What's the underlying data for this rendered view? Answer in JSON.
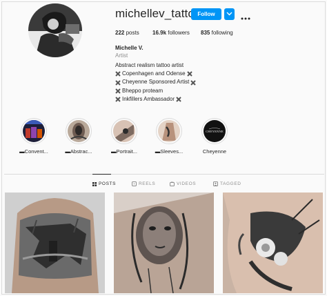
{
  "profile": {
    "username": "michellev_tattoo",
    "follow_label": "Follow",
    "posts_count": "222",
    "posts_label": "posts",
    "followers_count": "16.9k",
    "followers_label": "followers",
    "following_count": "835",
    "following_label": "following",
    "full_name": "Michelle V.",
    "category": "Artist",
    "bio_line1": "Abstract realism tattoo artist",
    "bio_line2": "Copenhagen and Odense",
    "bio_line3": "Cheyenne Sponsored Artist",
    "bio_line4": "Bheppo proteam",
    "bio_line5": "Inkfillers Ambassador"
  },
  "highlights": [
    {
      "label": "▬Convent..."
    },
    {
      "label": "▬Abstrac..."
    },
    {
      "label": "▬Portrait..."
    },
    {
      "label": "▬Sleeves..."
    },
    {
      "label": "Cheyenne"
    }
  ],
  "highlight_logo_text": "CHEYENNE",
  "tabs": {
    "posts": "POSTS",
    "reels": "REELS",
    "videos": "VIDEOS",
    "tagged": "TAGGED"
  },
  "colors": {
    "follow_blue": "#0095f6",
    "text": "#262626",
    "muted": "#8e8e8e",
    "border": "#dbdbdb"
  }
}
